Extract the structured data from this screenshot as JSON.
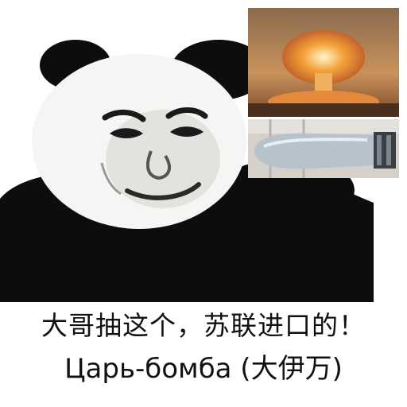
{
  "meme": {
    "caption_line1": "大哥抽这个，苏联进口的！",
    "caption_line2": "Царь-бомба (大伊万)"
  },
  "colors": {
    "background": "#ffffff",
    "panda_black": "#0d0d0d",
    "caption_text": "#111111",
    "explosion_orange": "#f4a23a",
    "sky_brown": "#b9895a",
    "bomb_body": "#b7c3cc"
  }
}
